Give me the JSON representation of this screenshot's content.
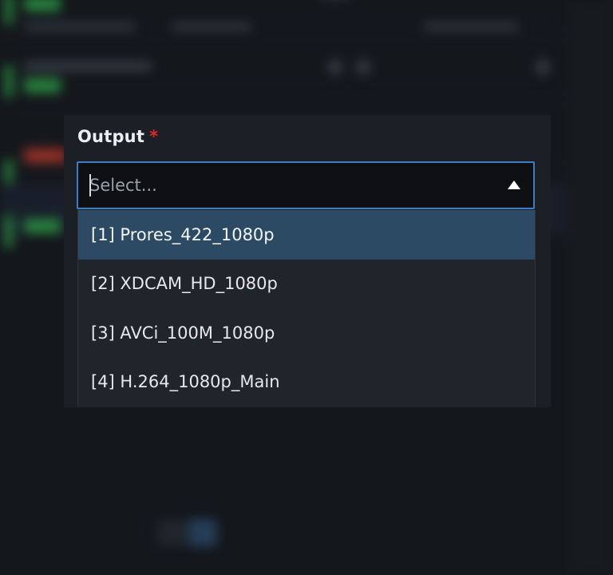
{
  "form": {
    "field_label": "Output",
    "required_marker": "*",
    "placeholder": "Select...",
    "dropdown_icon": "chevron-up-icon"
  },
  "options": [
    {
      "label": "[1] Prores_422_1080p",
      "highlighted": true
    },
    {
      "label": "[2] XDCAM_HD_1080p",
      "highlighted": false
    },
    {
      "label": "[3] AVCi_100M_1080p",
      "highlighted": false
    },
    {
      "label": "[4] H.264_1080p_Main",
      "highlighted": false
    }
  ],
  "colors": {
    "accent_border": "#3c7ec1",
    "highlight_bg": "#2c4a63",
    "required": "#e0262c",
    "status_green": "#2fa84a",
    "status_red": "#c0392b"
  }
}
